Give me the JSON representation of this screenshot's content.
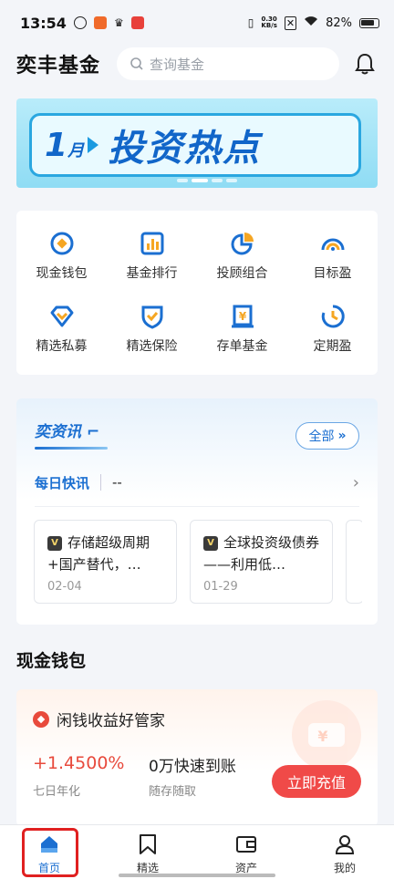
{
  "status_bar": {
    "time": "13:54",
    "speed_top": "0.30",
    "speed_bottom": "KB/s",
    "battery": "82%"
  },
  "header": {
    "title": "奕丰基金",
    "search_placeholder": "查询基金"
  },
  "banner": {
    "month": "1",
    "month_unit": "月",
    "text": "投资热点"
  },
  "grid": [
    {
      "label": "现金钱包"
    },
    {
      "label": "基金排行"
    },
    {
      "label": "投顾组合"
    },
    {
      "label": "目标盈"
    },
    {
      "label": "精选私募"
    },
    {
      "label": "精选保险"
    },
    {
      "label": "存单基金"
    },
    {
      "label": "定期盈"
    }
  ],
  "news": {
    "logo": "奕资讯",
    "all_label": "全部",
    "flash_label": "每日快讯",
    "flash_text": "--",
    "items": [
      {
        "badge": "V",
        "title": "存储超级周期+国产替代，…",
        "date": "02-04"
      },
      {
        "badge": "V",
        "title": "全球投资级债券——利用低…",
        "date": "01-29"
      }
    ]
  },
  "cash": {
    "section_title": "现金钱包",
    "header": "闲钱收益好管家",
    "rate": "+1.4500%",
    "rate_label": "七日年化",
    "speed": "0万快速到账",
    "speed_label": "随存随取",
    "button": "立即充值"
  },
  "tabs": [
    {
      "label": "首页"
    },
    {
      "label": "精选"
    },
    {
      "label": "资产"
    },
    {
      "label": "我的"
    }
  ],
  "colors": {
    "accent": "#1b6fd1",
    "red": "#f04a48"
  }
}
